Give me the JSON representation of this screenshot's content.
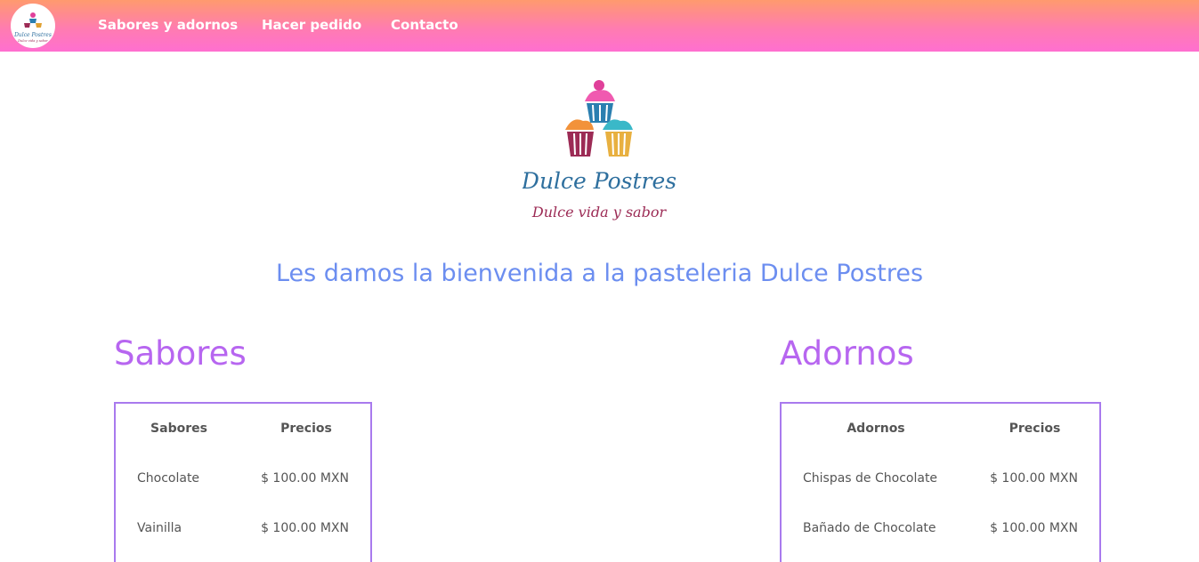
{
  "navbar": {
    "logo_icon": "cupcake-logo-icon",
    "links": [
      {
        "label": "Sabores y adornos"
      },
      {
        "label": "Hacer pedido"
      },
      {
        "label": "Contacto"
      }
    ]
  },
  "hero": {
    "logo_title": "Dulce Postres",
    "logo_tagline": "Dulce vida y sabor",
    "welcome": "Les damos la bienvenida a la pasteleria Dulce Postres"
  },
  "sabores": {
    "title": "Sabores",
    "headers": [
      "Sabores",
      "Precios"
    ],
    "rows": [
      {
        "name": "Chocolate",
        "price": "$ 100.00 MXN"
      },
      {
        "name": "Vainilla",
        "price": "$ 100.00 MXN"
      }
    ]
  },
  "adornos": {
    "title": "Adornos",
    "headers": [
      "Adornos",
      "Precios"
    ],
    "rows": [
      {
        "name": "Chispas de Chocolate",
        "price": "$ 100.00 MXN"
      },
      {
        "name": "Bañado de Chocolate",
        "price": "$ 100.00 MXN"
      }
    ]
  },
  "colors": {
    "nav_gradient_top": "#ff9a6e",
    "nav_gradient_bottom": "#ff6fd0",
    "welcome_text": "#6c8ef0",
    "section_title": "#b766f0",
    "table_border": "#a97aee",
    "logo_text": "#2e6f9e",
    "tagline_text": "#9c2b55"
  }
}
